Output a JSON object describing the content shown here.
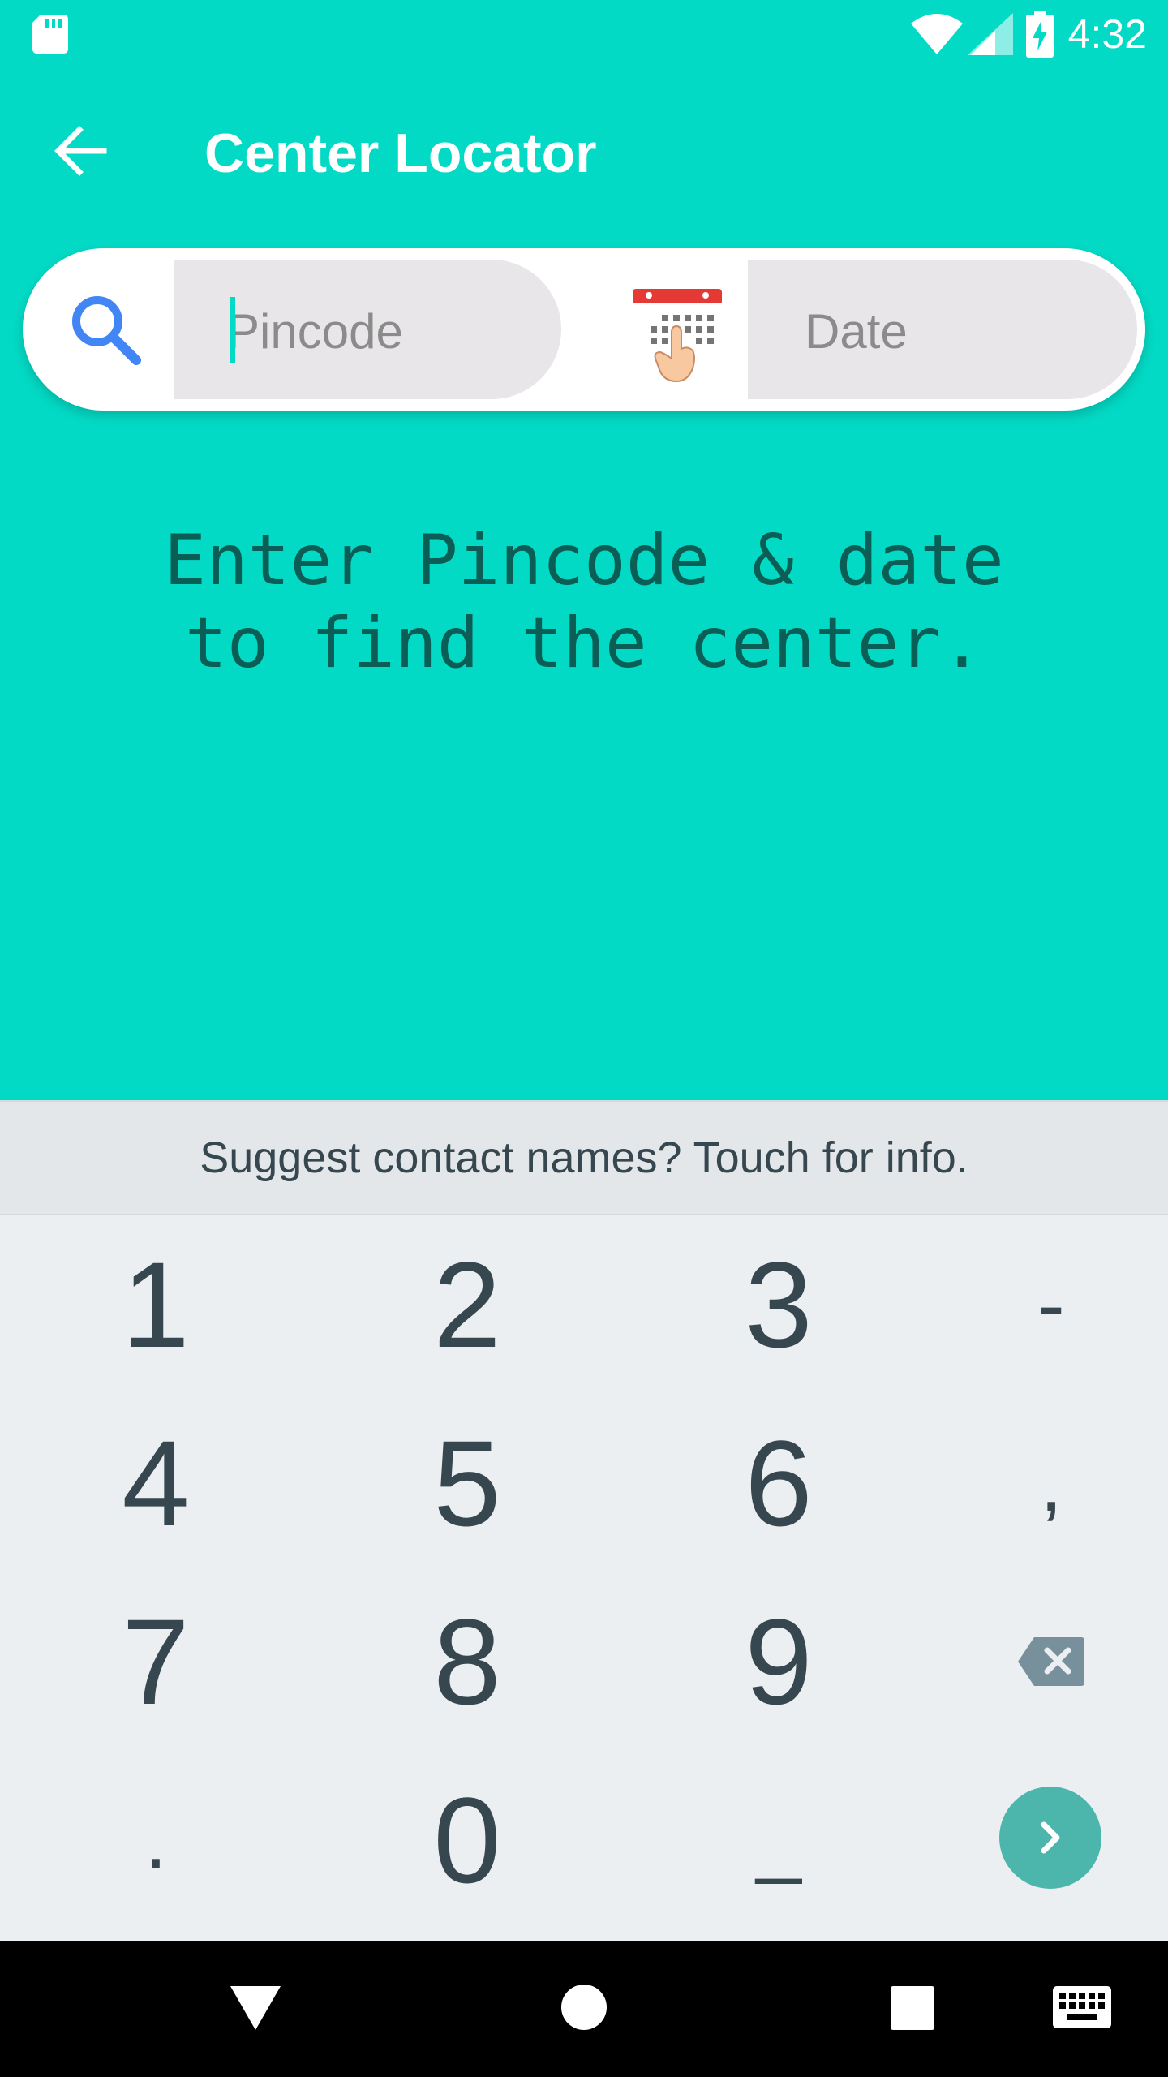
{
  "status_bar": {
    "time": "4:32",
    "icons": [
      "sd-card-icon",
      "wifi-icon",
      "signal-icon",
      "battery-charging-icon"
    ]
  },
  "app_bar": {
    "title": "Center Locator",
    "back_icon": "arrow-left-icon"
  },
  "search": {
    "pincode_placeholder": "Pincode",
    "pincode_value": "",
    "date_placeholder": "Date",
    "date_value": "",
    "search_icon": "search-icon",
    "calendar_icon": "calendar-tap-icon"
  },
  "message": {
    "line1": "Enter Pincode & date",
    "line2": "to find the center."
  },
  "suggestion": {
    "text": "Suggest contact names? Touch for info."
  },
  "keyboard": {
    "rows": [
      [
        "1",
        "2",
        "3",
        "-"
      ],
      [
        "4",
        "5",
        "6",
        ","
      ],
      [
        "7",
        "8",
        "9",
        "⌫"
      ],
      [
        ".",
        "0",
        "_",
        "›"
      ]
    ]
  },
  "colors": {
    "accent": "#03DAC5",
    "message_text": "#0B5E55",
    "key_text": "#37474F",
    "enter_key": "#4DB6AC",
    "field_bg": "#E8E6E8"
  },
  "nav_bar": {
    "icons": [
      "back-triangle-icon",
      "home-circle-icon",
      "recents-square-icon",
      "keyboard-icon"
    ]
  }
}
